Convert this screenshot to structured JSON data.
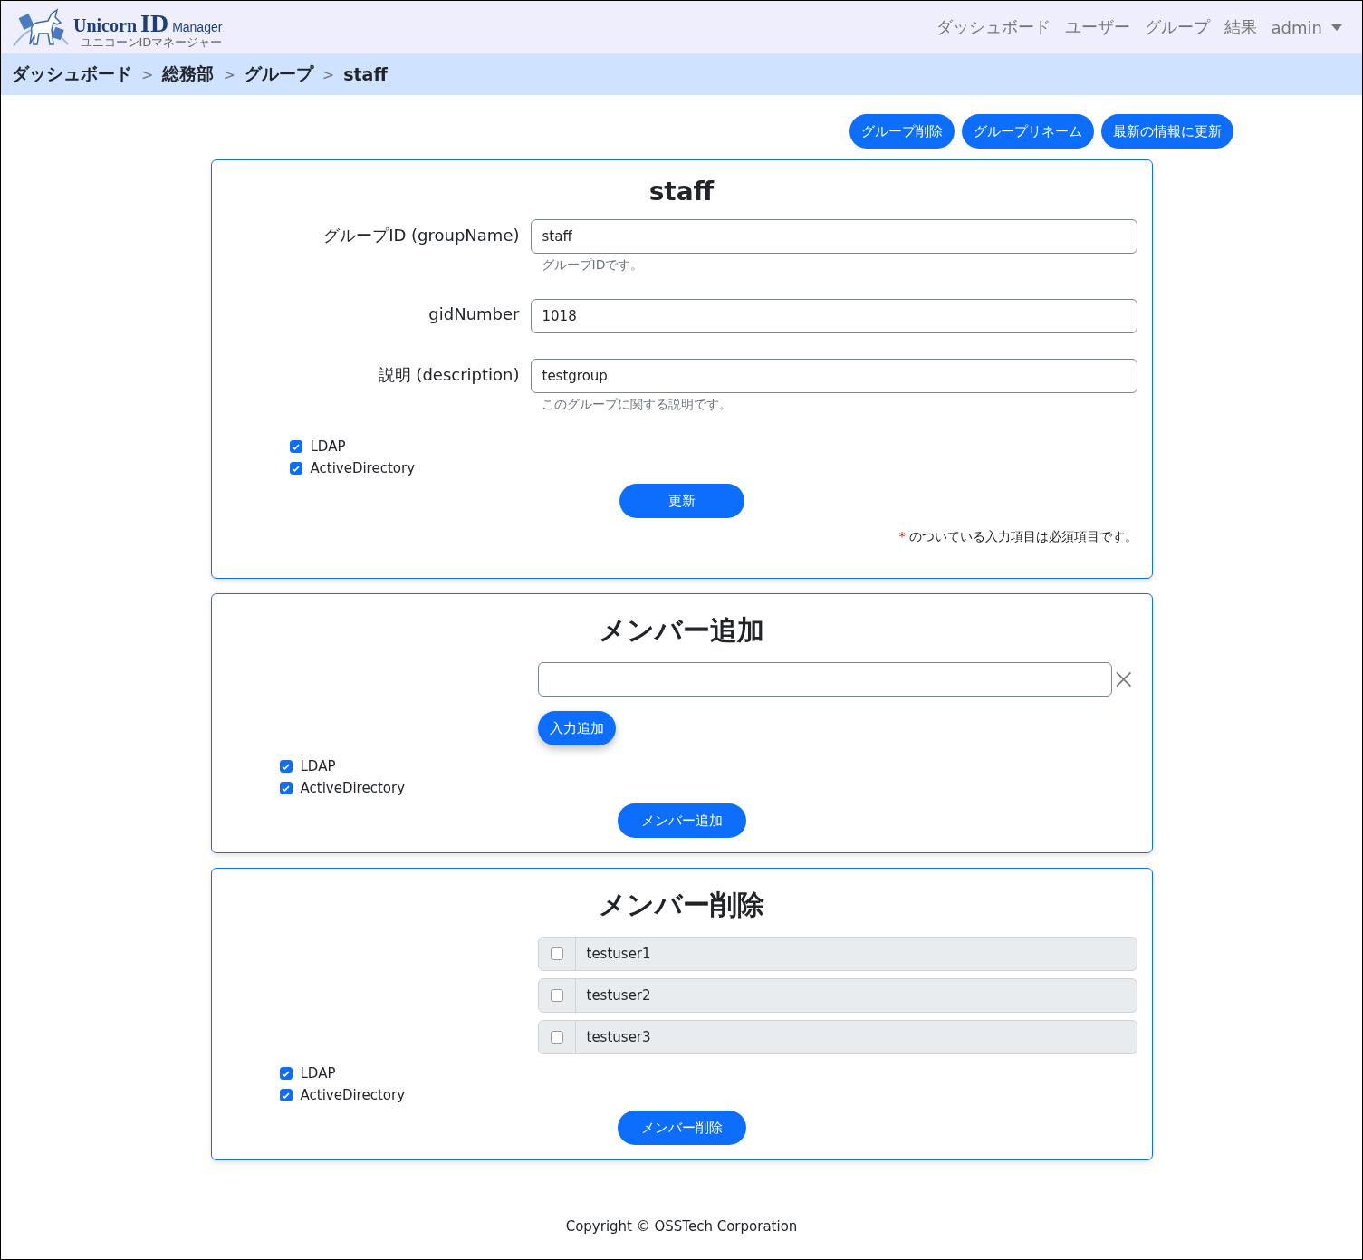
{
  "navbar": {
    "logo": {
      "words": [
        "Unicorn",
        "ID",
        "Manager"
      ],
      "subtitle": "ユニコーンIDマネージャー"
    },
    "links": [
      {
        "label": "ダッシュボード",
        "kind": "link"
      },
      {
        "label": "ユーザー",
        "kind": "link"
      },
      {
        "label": "グループ",
        "kind": "link"
      },
      {
        "label": "結果",
        "kind": "link"
      },
      {
        "label": "admin",
        "kind": "dropdown"
      }
    ]
  },
  "breadcrumb": [
    "ダッシュボード",
    "総務部",
    "グループ",
    "staff"
  ],
  "breadcrumb_separator": ">",
  "actions": [
    "グループ削除",
    "グループリネーム",
    "最新の情報に更新"
  ],
  "group_card": {
    "title": "staff",
    "fields": [
      {
        "label": "グループID (groupName)",
        "value": "staff",
        "help": "グループIDです。"
      },
      {
        "label": "gidNumber",
        "value": "1018"
      },
      {
        "label": "説明 (description)",
        "value": "testgroup",
        "help": "このグループに関する説明です。"
      }
    ],
    "targets": [
      {
        "label": "LDAP",
        "checked": true
      },
      {
        "label": "ActiveDirectory",
        "checked": true
      }
    ],
    "submit": "更新",
    "required_mark": "*",
    "required_note": "のついている入力項目は必須項目です。"
  },
  "add_card": {
    "title": "メンバー追加",
    "add_input": "入力追加",
    "targets": [
      {
        "label": "LDAP",
        "checked": true
      },
      {
        "label": "ActiveDirectory",
        "checked": true
      }
    ],
    "submit": "メンバー追加"
  },
  "remove_card": {
    "title": "メンバー削除",
    "members": [
      {
        "name": "testuser1",
        "checked": false
      },
      {
        "name": "testuser2",
        "checked": false
      },
      {
        "name": "testuser3",
        "checked": false
      }
    ],
    "targets": [
      {
        "label": "LDAP",
        "checked": true
      },
      {
        "label": "ActiveDirectory",
        "checked": true
      }
    ],
    "submit": "メンバー削除"
  },
  "footer": "Copyright © OSSTech Corporation"
}
